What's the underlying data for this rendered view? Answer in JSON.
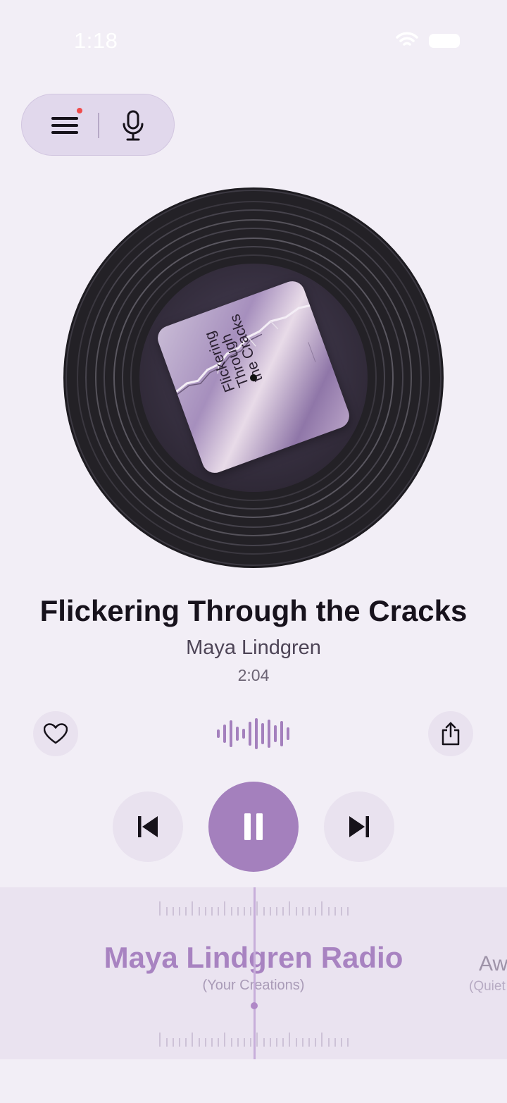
{
  "status_bar": {
    "time": "1:18"
  },
  "top_controls": {
    "menu_icon": "hamburger-menu-icon",
    "mic_icon": "microphone-icon",
    "notification_color": "#f04b4b"
  },
  "album": {
    "cover_title_lines": [
      "Flickering",
      "Through",
      "the Cracks"
    ]
  },
  "track": {
    "title": "Flickering Through the Cracks",
    "artist": "Maya Lindgren",
    "elapsed": "2:04"
  },
  "actions": {
    "like_icon": "heart-icon",
    "share_icon": "share-icon",
    "waveform_icon": "waveform-icon"
  },
  "playback": {
    "prev_icon": "skip-previous-icon",
    "pause_icon": "pause-icon",
    "next_icon": "skip-next-icon",
    "accent": "#a480bd"
  },
  "radio": {
    "current_station": "Maya Lindgren Radio",
    "current_station_sub": "(Your Creations)",
    "next_station": "Aw",
    "next_station_sub": "(Quiet"
  }
}
